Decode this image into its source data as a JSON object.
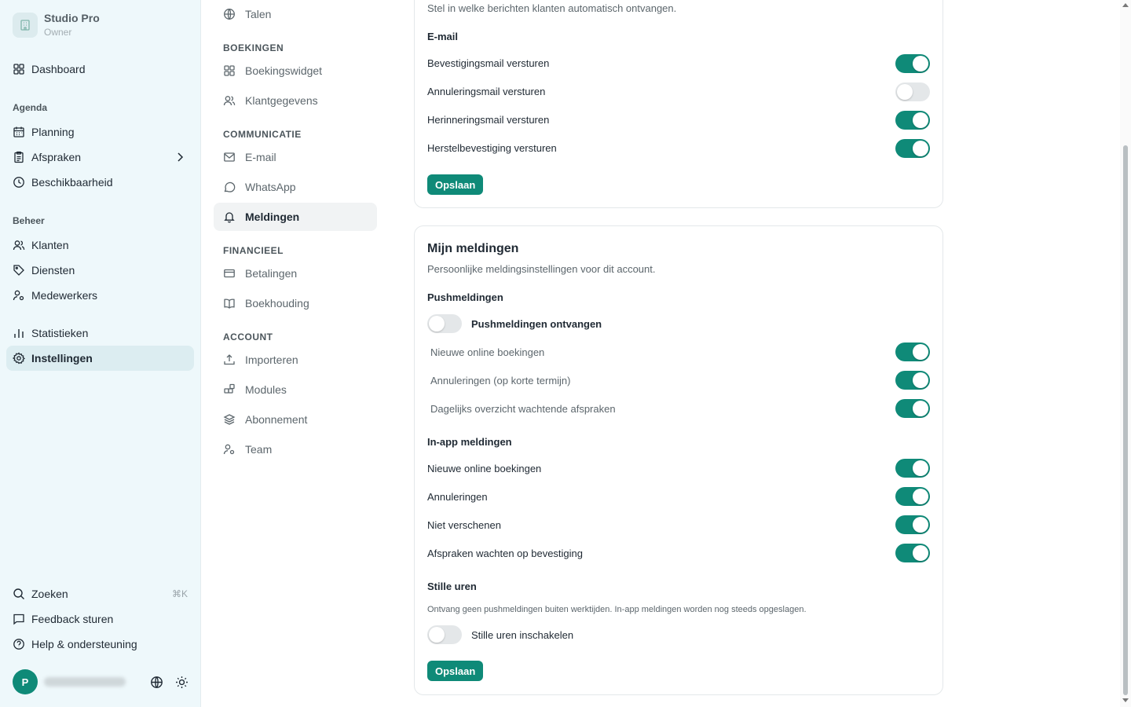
{
  "brand": {
    "name": "Studio Pro",
    "role": "Owner"
  },
  "sidebar": {
    "dashboard": "Dashboard",
    "agenda_section": "Agenda",
    "planning": "Planning",
    "afspraken": "Afspraken",
    "beschikbaarheid": "Beschikbaarheid",
    "beheer_section": "Beheer",
    "klanten": "Klanten",
    "diensten": "Diensten",
    "medewerkers": "Medewerkers",
    "statistieken": "Statistieken",
    "instellingen": "Instellingen",
    "zoeken": "Zoeken",
    "zoeken_shortcut": "⌘K",
    "feedback": "Feedback sturen",
    "help": "Help & ondersteuning",
    "avatar_initial": "P"
  },
  "submenu": {
    "talen": "Talen",
    "boekingen_section": "BOEKINGEN",
    "boekingswidget": "Boekingswidget",
    "klantgegevens": "Klantgegevens",
    "communicatie_section": "COMMUNICATIE",
    "email": "E-mail",
    "whatsapp": "WhatsApp",
    "meldingen": "Meldingen",
    "financieel_section": "FINANCIEEL",
    "betalingen": "Betalingen",
    "boekhouding": "Boekhouding",
    "account_section": "ACCOUNT",
    "importeren": "Importeren",
    "modules": "Modules",
    "abonnement": "Abonnement",
    "team": "Team"
  },
  "client_card": {
    "description": "Stel in welke berichten klanten automatisch ontvangen.",
    "email_title": "E-mail",
    "rows": [
      {
        "label": "Bevestigingsmail versturen",
        "on": true
      },
      {
        "label": "Annuleringsmail versturen",
        "on": false
      },
      {
        "label": "Herinneringsmail versturen",
        "on": true
      },
      {
        "label": "Herstelbevestiging versturen",
        "on": true
      }
    ],
    "save": "Opslaan"
  },
  "my_card": {
    "title": "Mijn meldingen",
    "description": "Persoonlijke meldingsinstellingen voor dit account.",
    "push_title": "Pushmeldingen",
    "push_master": {
      "label": "Pushmeldingen ontvangen",
      "on": false
    },
    "push_rows": [
      {
        "label": "Nieuwe online boekingen",
        "on": true
      },
      {
        "label": "Annuleringen (op korte termijn)",
        "on": true
      },
      {
        "label": "Dagelijks overzicht wachtende afspraken",
        "on": true
      }
    ],
    "inapp_title": "In-app meldingen",
    "inapp_rows": [
      {
        "label": "Nieuwe online boekingen",
        "on": true
      },
      {
        "label": "Annuleringen",
        "on": true
      },
      {
        "label": "Niet verschenen",
        "on": true
      },
      {
        "label": "Afspraken wachten op bevestiging",
        "on": true
      }
    ],
    "quiet_title": "Stille uren",
    "quiet_note": "Ontvang geen pushmeldingen buiten werktijden. In-app meldingen worden nog steeds opgeslagen.",
    "quiet_toggle": {
      "label": "Stille uren inschakelen",
      "on": false
    },
    "save": "Opslaan"
  },
  "colors": {
    "accent": "#0f8a78",
    "sidebar_bg": "#eef8fb",
    "toggle_off": "#e4e7e9"
  }
}
